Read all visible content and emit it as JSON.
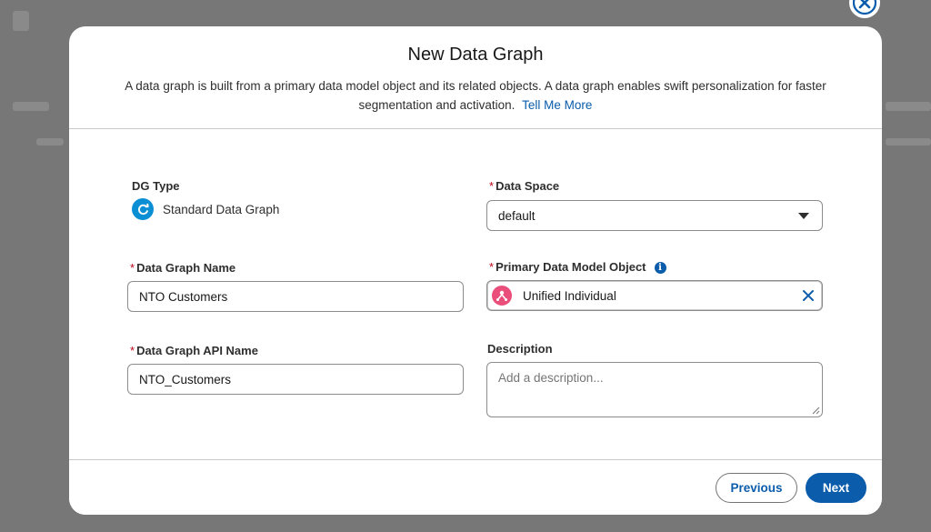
{
  "modal": {
    "title": "New Data Graph",
    "description": "A data graph is built from a primary data model object and its related objects. A data graph enables swift personalization for faster segmentation and activation.",
    "tell_me_more": "Tell Me More"
  },
  "form": {
    "dg_type": {
      "label": "DG Type",
      "value": "Standard Data Graph",
      "icon": "refresh-icon"
    },
    "data_space": {
      "label": "Data Space",
      "required": "*",
      "value": "default",
      "icon": "chevron-down-icon"
    },
    "data_graph_name": {
      "label": "Data Graph Name",
      "required": "*",
      "value": "NTO Customers"
    },
    "primary_object": {
      "label": "Primary Data Model Object",
      "required": "*",
      "value": "Unified Individual",
      "icon": "unified-individual-icon",
      "info_icon": "i"
    },
    "api_name": {
      "label": "Data Graph API Name",
      "required": "*",
      "value": "NTO_Customers"
    },
    "description": {
      "label": "Description",
      "placeholder": "Add a description..."
    }
  },
  "footer": {
    "previous_label": "Previous",
    "next_label": "Next"
  },
  "colors": {
    "brand": "#0b5cab",
    "required": "#ba0517",
    "object_icon": "#ea4f7b",
    "dg_icon": "#0b8fd4"
  }
}
